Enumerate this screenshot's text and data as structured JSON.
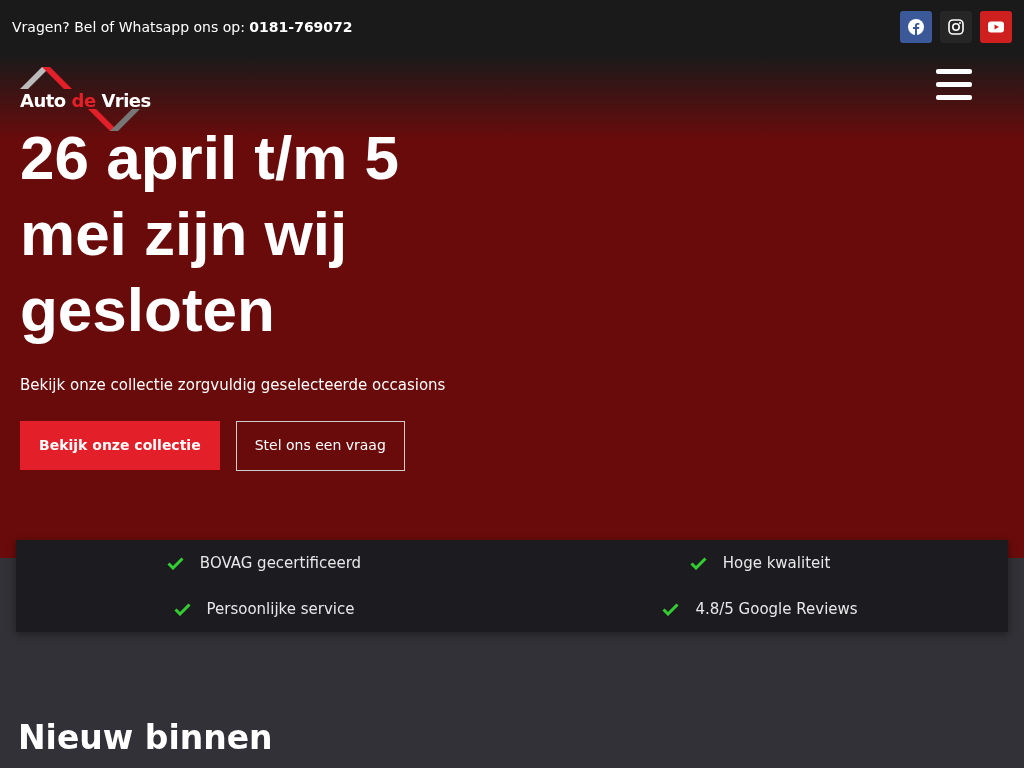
{
  "topbar": {
    "text": "Vragen? Bel of Whatsapp ons op: **0181-769072**",
    "social": [
      {
        "kind": "facebook",
        "color": "#3b5998"
      },
      {
        "kind": "instagram",
        "color": "#262626"
      },
      {
        "kind": "youtube",
        "color": "#cd201f"
      }
    ]
  },
  "logo": {
    "before": "Auto",
    "accent": "de",
    "after": "Vries"
  },
  "hero": {
    "title": "26 april t/m 5 mei zijn wij gesloten",
    "subtitle": "Bekijk onze collectie zorgvuldig geselecteerde occasions",
    "buttons": [
      {
        "label": "Bekijk onze collectie",
        "kind": "primary"
      },
      {
        "label": "Stel ons een vraag",
        "kind": "outline"
      }
    ]
  },
  "features": [
    "BOVAG gecertificeerd",
    "Hoge kwaliteit",
    "Persoonlijke service",
    "4.8/5 Google Reviews"
  ],
  "section": {
    "title": "Nieuw binnen"
  }
}
